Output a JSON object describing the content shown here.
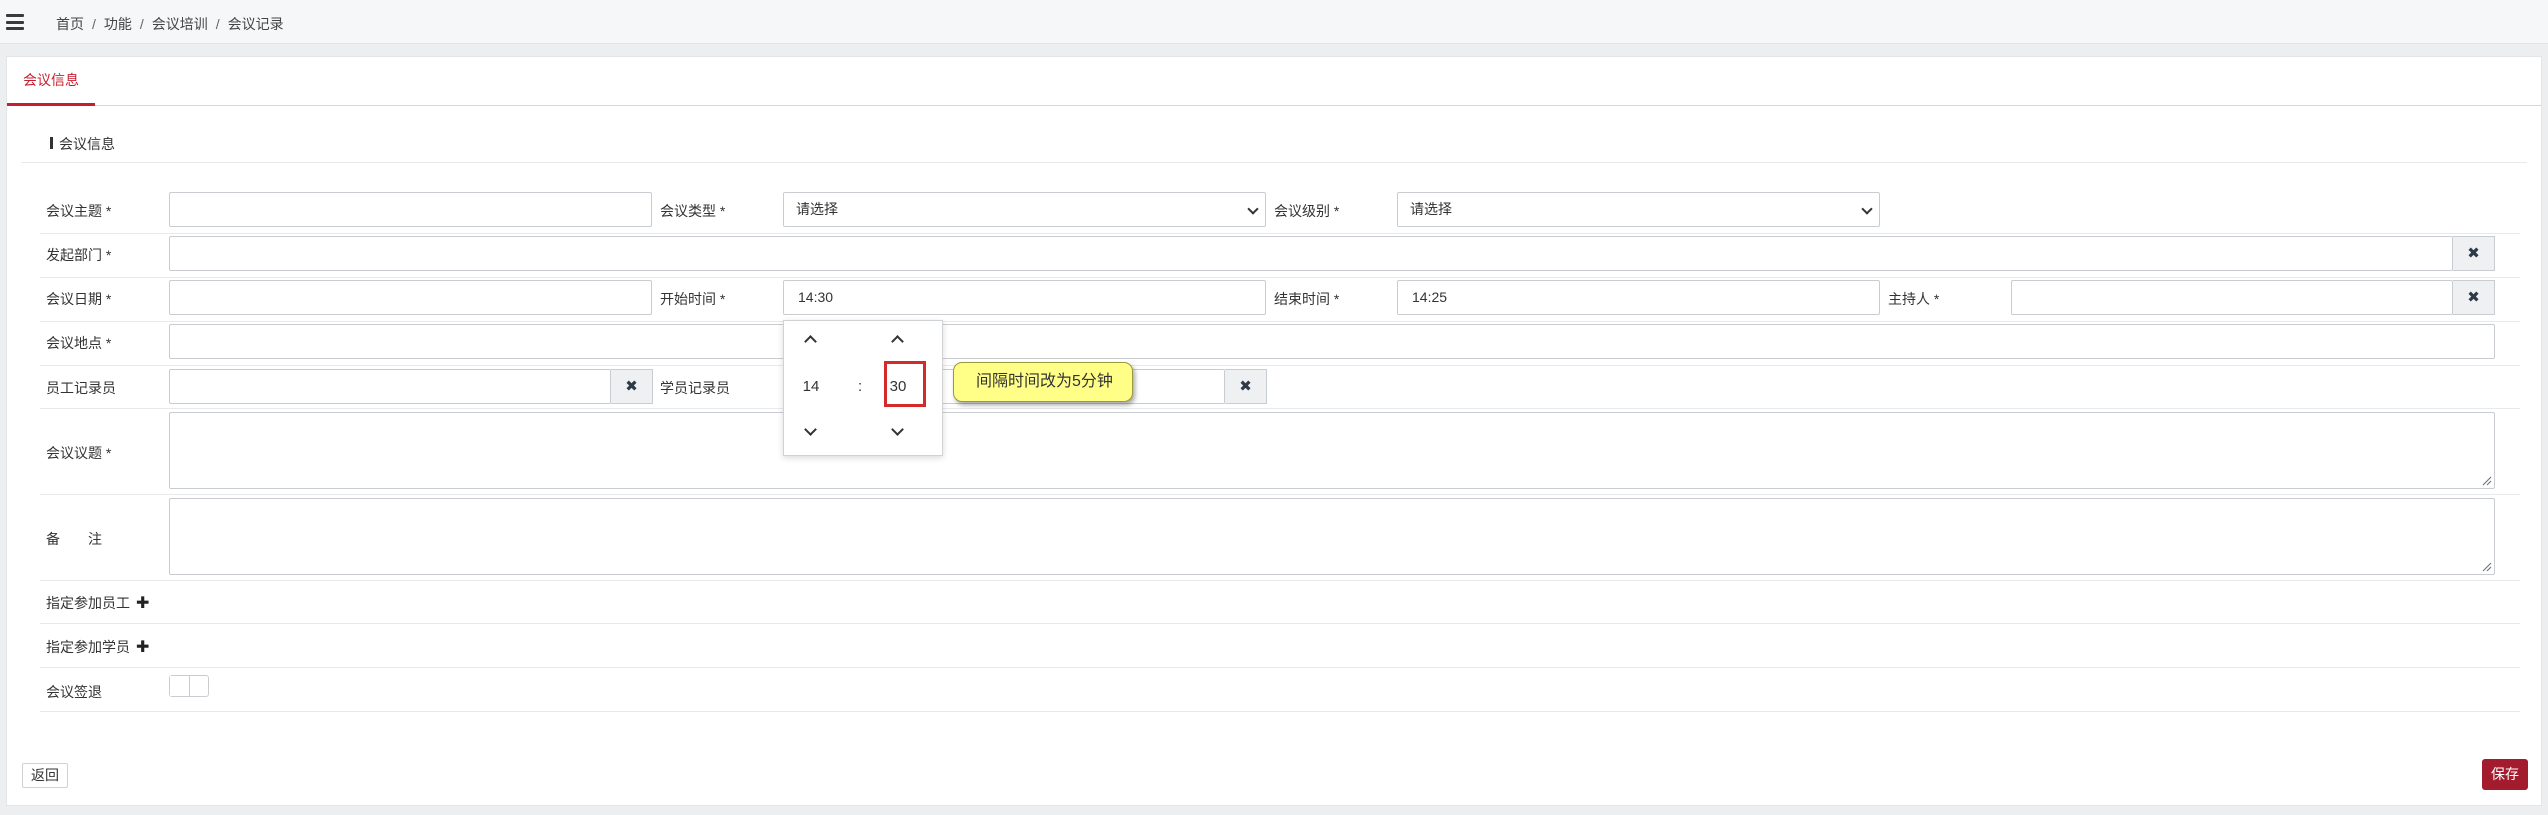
{
  "breadcrumb": [
    "首页",
    "功能",
    "会议培训",
    "会议记录"
  ],
  "breadcrumb_sep": "/",
  "tab": {
    "label": "会议信息"
  },
  "section": {
    "title": "会议信息"
  },
  "form": {
    "subject_label": "会议主题 *",
    "type_label": "会议类型 *",
    "type_value": "请选择",
    "level_label": "会议级别 *",
    "level_value": "请选择",
    "dept_label": "发起部门 *",
    "date_label": "会议日期 *",
    "start_label": "开始时间 *",
    "start_value": "14:30",
    "end_label": "结束时间 *",
    "end_value": "14:25",
    "host_label": "主持人 *",
    "location_label": "会议地点 *",
    "staff_recorder_label": "员工记录员",
    "student_recorder_label": "学员记录员",
    "topic_label": "会议议题 *",
    "remark_label": "备　　注",
    "assign_staff_label": "指定参加员工",
    "assign_student_label": "指定参加学员",
    "signout_label": "会议签退",
    "signout_enabled": false
  },
  "clear_icon_glyph": "✖",
  "plus_glyph": "✚",
  "time_picker": {
    "hour": "14",
    "colon": ":",
    "minute": "30"
  },
  "annotation": {
    "text": "间隔时间改为5分钟",
    "color": "#ffff88"
  },
  "buttons": {
    "back": "返回",
    "save": "保存"
  },
  "colors": {
    "accent": "#c81d2e",
    "save_bg": "#a31c2e"
  }
}
